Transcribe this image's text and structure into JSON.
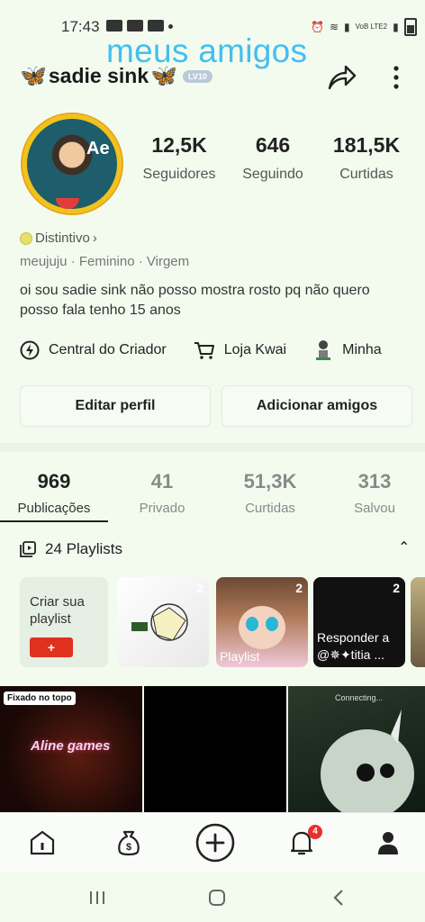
{
  "status_bar": {
    "time": "17:43",
    "network": "VoB LTE2"
  },
  "overlay_text": "meus amigos",
  "profile": {
    "name": "sadie sink",
    "level": "LV10",
    "stats": [
      {
        "value": "12,5K",
        "label": "Seguidores"
      },
      {
        "value": "646",
        "label": "Seguindo"
      },
      {
        "value": "181,5K",
        "label": "Curtidas"
      }
    ],
    "badge": "Distintivo",
    "meta": "meujuju · Feminino · Virgem",
    "bio": "oi sou sadie sink não posso mostra rosto pq não quero posso fala tenho 15 anos"
  },
  "links": {
    "creator": "Central do Criador",
    "shop": "Loja Kwai",
    "more": "Minha"
  },
  "buttons": {
    "edit": "Editar perfil",
    "add_friends": "Adicionar amigos"
  },
  "tabs": [
    {
      "value": "969",
      "label": "Publicações"
    },
    {
      "value": "41",
      "label": "Privado"
    },
    {
      "value": "51,3K",
      "label": "Curtidas"
    },
    {
      "value": "313",
      "label": "Salvou"
    }
  ],
  "playlists": {
    "header": "24 Playlists",
    "create_label": "Criar sua playlist",
    "create_button": "+",
    "items": [
      {
        "count": "2",
        "label": ""
      },
      {
        "count": "2",
        "label": "Playlist"
      },
      {
        "count": "2",
        "label": "Responder a @✵✦titia ..."
      }
    ]
  },
  "videos": {
    "pinned_tag": "Fixado no topo",
    "first_title": "Aline games",
    "connecting": "Connecting..."
  },
  "bottom_nav": {
    "notification_count": "4"
  }
}
